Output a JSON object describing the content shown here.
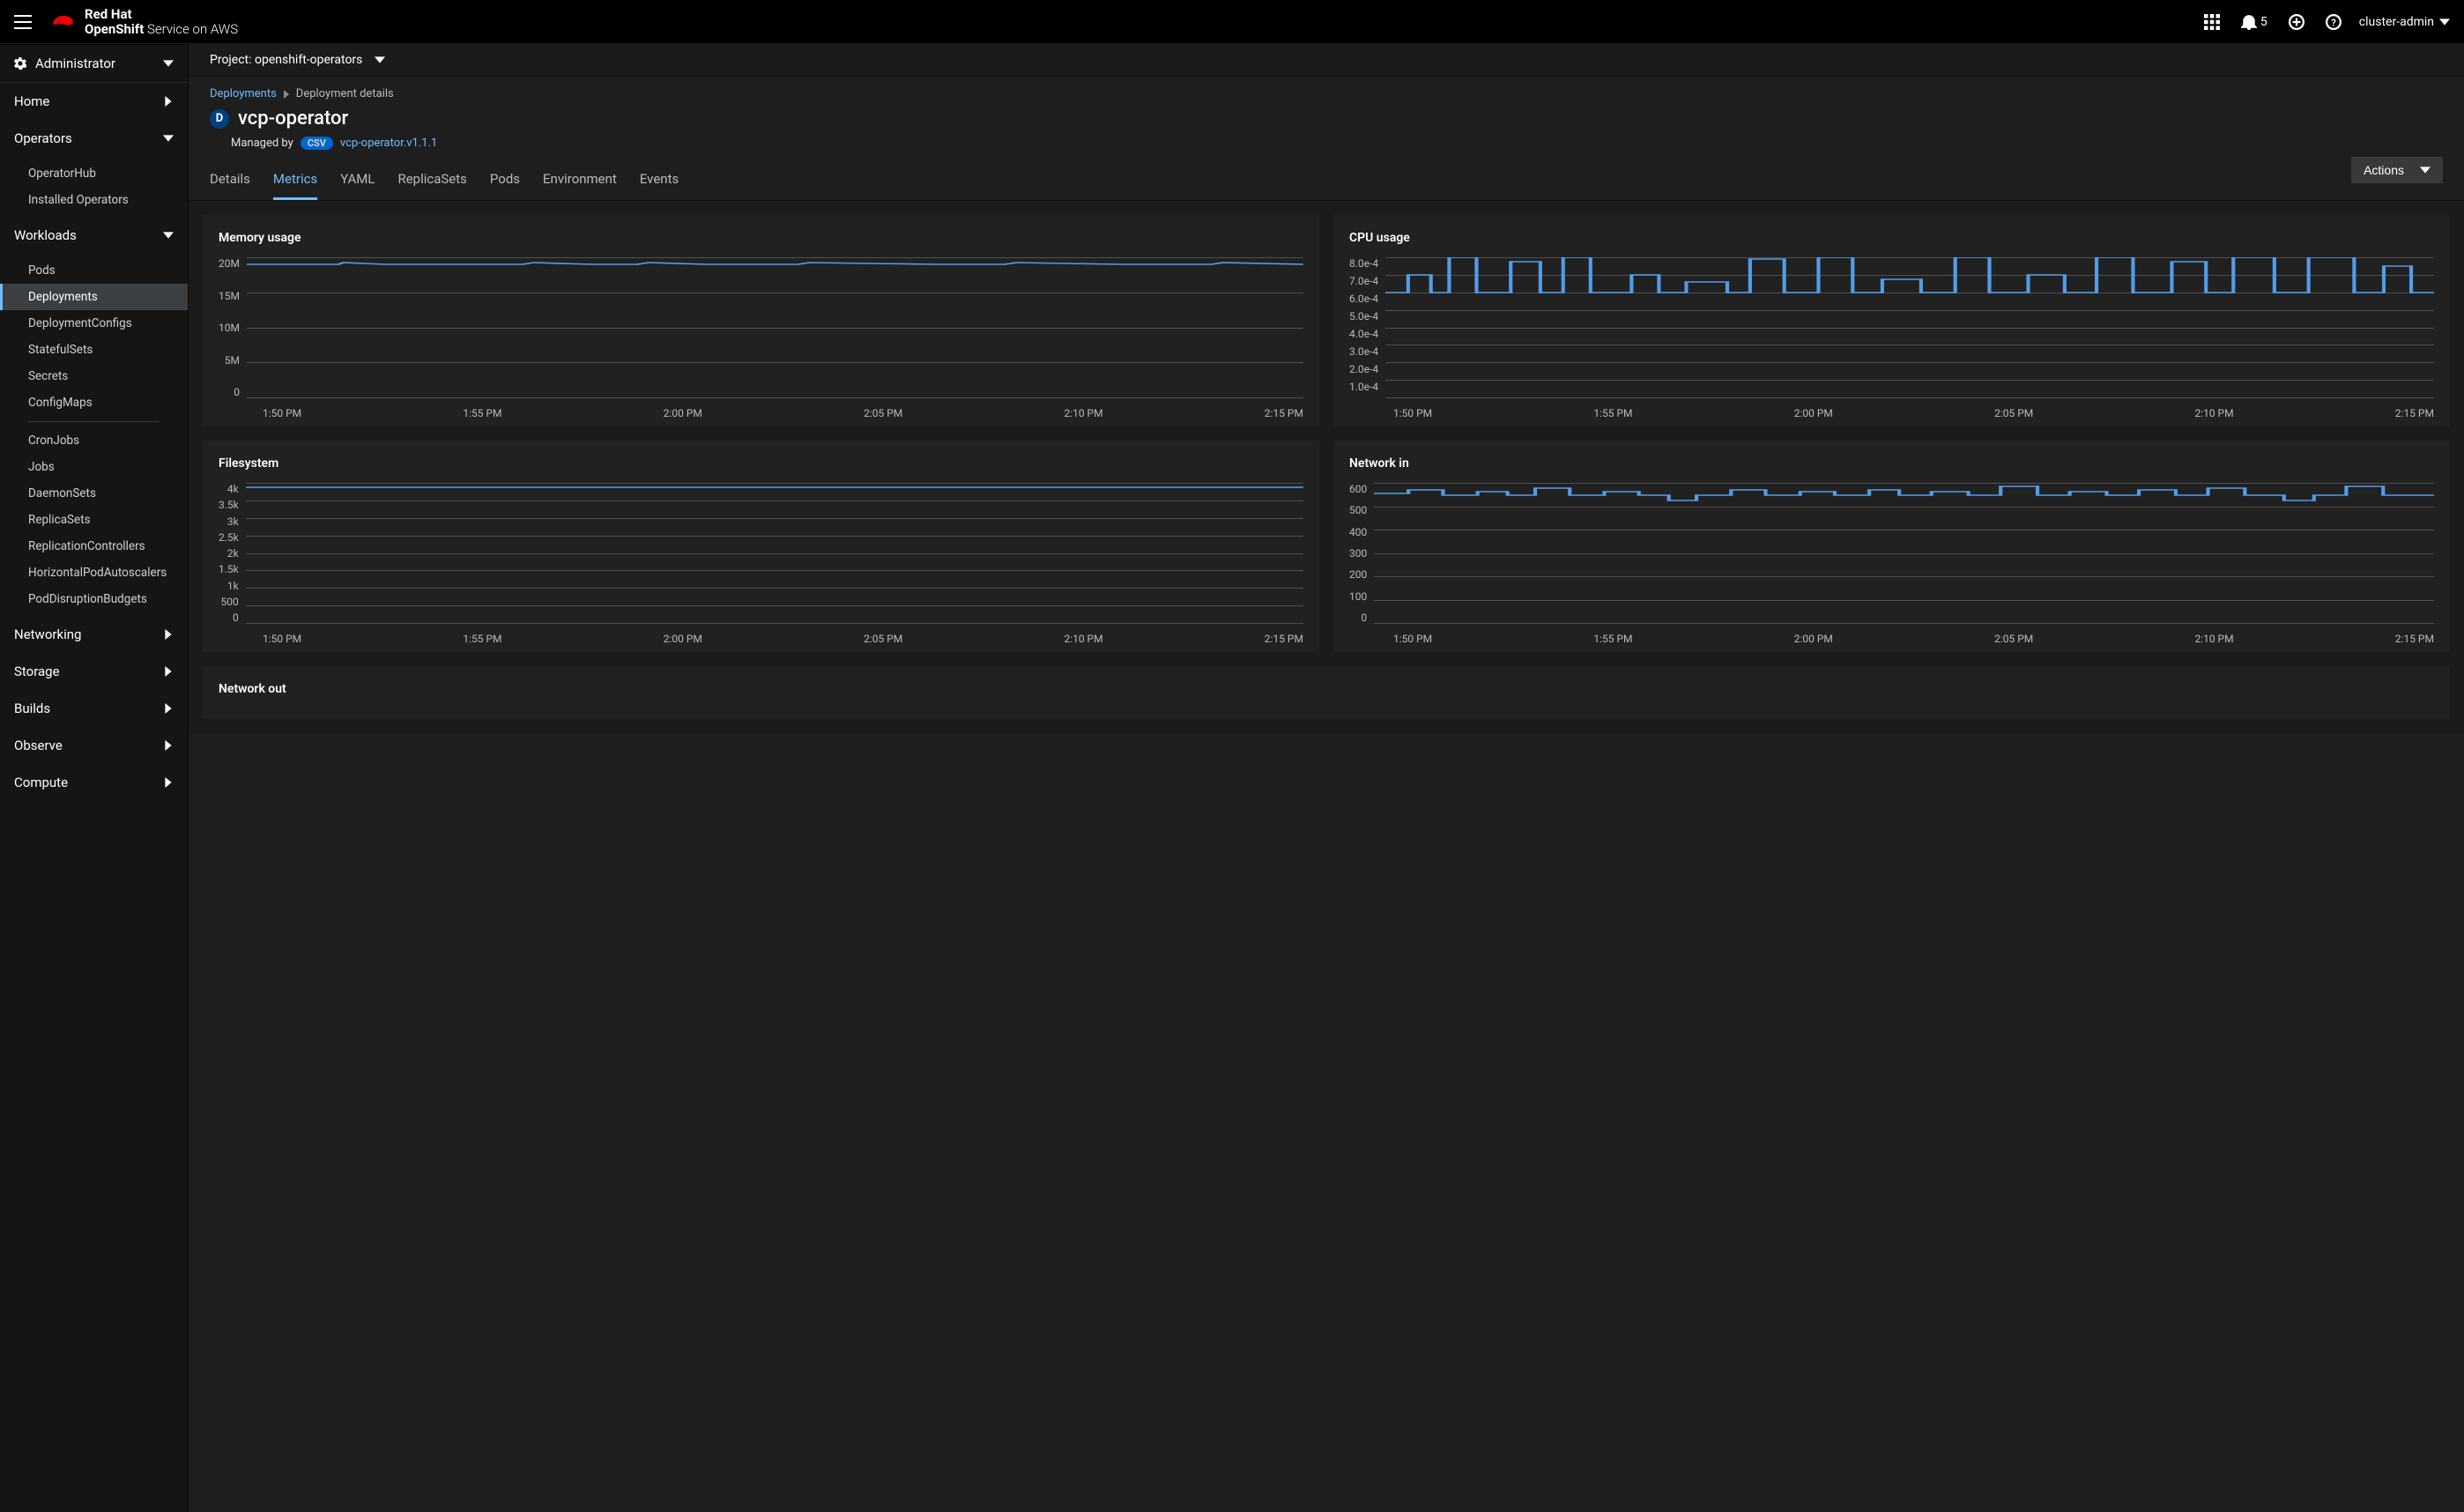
{
  "brand": {
    "l1": "Red Hat",
    "l2_bold": "OpenShift",
    "l2_rest": " Service on AWS"
  },
  "topbar": {
    "notif_count": "5",
    "user": "cluster-admin"
  },
  "sidebar": {
    "perspective": "Administrator",
    "sections": [
      {
        "label": "Home",
        "collapsed": true
      },
      {
        "label": "Operators",
        "collapsed": false,
        "items": [
          "OperatorHub",
          "Installed Operators"
        ]
      },
      {
        "label": "Workloads",
        "collapsed": false,
        "items": [
          "Pods",
          "Deployments",
          "DeploymentConfigs",
          "StatefulSets",
          "Secrets",
          "ConfigMaps",
          "__sep__",
          "CronJobs",
          "Jobs",
          "DaemonSets",
          "ReplicaSets",
          "ReplicationControllers",
          "HorizontalPodAutoscalers",
          "PodDisruptionBudgets"
        ],
        "active": "Deployments"
      },
      {
        "label": "Networking",
        "collapsed": true
      },
      {
        "label": "Storage",
        "collapsed": true
      },
      {
        "label": "Builds",
        "collapsed": true
      },
      {
        "label": "Observe",
        "collapsed": true
      },
      {
        "label": "Compute",
        "collapsed": true
      }
    ]
  },
  "project": {
    "label": "Project:",
    "value": "openshift-operators"
  },
  "breadcrumb": {
    "root": "Deployments",
    "current": "Deployment details"
  },
  "deployment": {
    "badge": "D",
    "name": "vcp-operator",
    "managed_label": "Managed by",
    "csv_pill": "CSV",
    "csv_link": "vcp-operator.v1.1.1",
    "actions_label": "Actions"
  },
  "tabs": [
    "Details",
    "Metrics",
    "YAML",
    "ReplicaSets",
    "Pods",
    "Environment",
    "Events"
  ],
  "active_tab": "Metrics",
  "x_ticks": [
    "1:50 PM",
    "1:55 PM",
    "2:00 PM",
    "2:05 PM",
    "2:10 PM",
    "2:15 PM"
  ],
  "cards": {
    "memory": {
      "title": "Memory usage",
      "y": [
        "20M",
        "15M",
        "10M",
        "5M",
        "0"
      ]
    },
    "cpu": {
      "title": "CPU usage",
      "y": [
        "8.0e-4",
        "7.0e-4",
        "6.0e-4",
        "5.0e-4",
        "4.0e-4",
        "3.0e-4",
        "2.0e-4",
        "1.0e-4",
        ""
      ]
    },
    "fs": {
      "title": "Filesystem",
      "y": [
        "4k",
        "3.5k",
        "3k",
        "2.5k",
        "2k",
        "1.5k",
        "1k",
        "500",
        "0"
      ]
    },
    "netin": {
      "title": "Network in",
      "y": [
        "600",
        "500",
        "400",
        "300",
        "200",
        "100",
        "0"
      ]
    },
    "netout": {
      "title": "Network out"
    }
  },
  "chart_data": [
    {
      "type": "line",
      "title": "Memory usage",
      "x": [
        "1:50 PM",
        "1:55 PM",
        "2:00 PM",
        "2:05 PM",
        "2:10 PM",
        "2:15 PM"
      ],
      "ylabel": "",
      "ylim": [
        0,
        22000000
      ],
      "series": [
        {
          "name": "memory",
          "values": [
            22000000,
            22000000,
            22000000,
            22000000,
            22000000,
            22000000
          ]
        }
      ]
    },
    {
      "type": "line",
      "title": "CPU usage",
      "x": [
        "1:50 PM",
        "1:55 PM",
        "2:00 PM",
        "2:05 PM",
        "2:10 PM",
        "2:15 PM"
      ],
      "ylabel": "",
      "ylim": [
        0,
        0.0008
      ],
      "series": [
        {
          "name": "cpu",
          "values": [
            0.0006,
            0.00065,
            0.0006,
            0.0007,
            0.00065,
            0.0006
          ]
        }
      ],
      "note": "oscillates between ~6e-4 and ~8e-4"
    },
    {
      "type": "line",
      "title": "Filesystem",
      "x": [
        "1:50 PM",
        "1:55 PM",
        "2:00 PM",
        "2:05 PM",
        "2:10 PM",
        "2:15 PM"
      ],
      "ylabel": "",
      "ylim": [
        0,
        4000
      ],
      "series": [
        {
          "name": "fs",
          "values": [
            4000,
            4000,
            4000,
            4000,
            4000,
            4000
          ]
        }
      ]
    },
    {
      "type": "line",
      "title": "Network in",
      "x": [
        "1:50 PM",
        "1:55 PM",
        "2:00 PM",
        "2:05 PM",
        "2:10 PM",
        "2:15 PM"
      ],
      "ylabel": "",
      "ylim": [
        0,
        650
      ],
      "series": [
        {
          "name": "net_in",
          "values": [
            620,
            610,
            620,
            630,
            615,
            620
          ]
        }
      ],
      "note": "oscillates around 600–650"
    }
  ]
}
